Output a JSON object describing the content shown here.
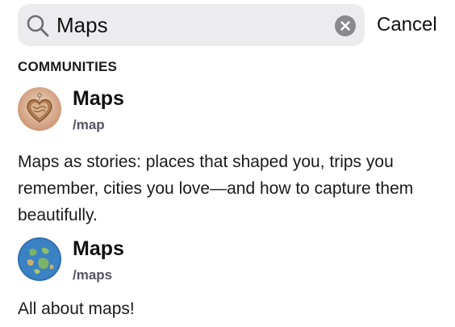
{
  "search": {
    "query": "Maps",
    "cancel_label": "Cancel"
  },
  "section": {
    "title": "COMMUNITIES"
  },
  "communities": [
    {
      "name": "Maps",
      "handle": "/map",
      "description": "Maps as stories: places that shaped you, trips you remember, cities you love—and how to capture them beautifully.",
      "avatar_icon": "heart-wood-icon"
    },
    {
      "name": "Maps",
      "handle": "/maps",
      "description": "All about maps!",
      "avatar_icon": "globe-icon"
    }
  ]
}
